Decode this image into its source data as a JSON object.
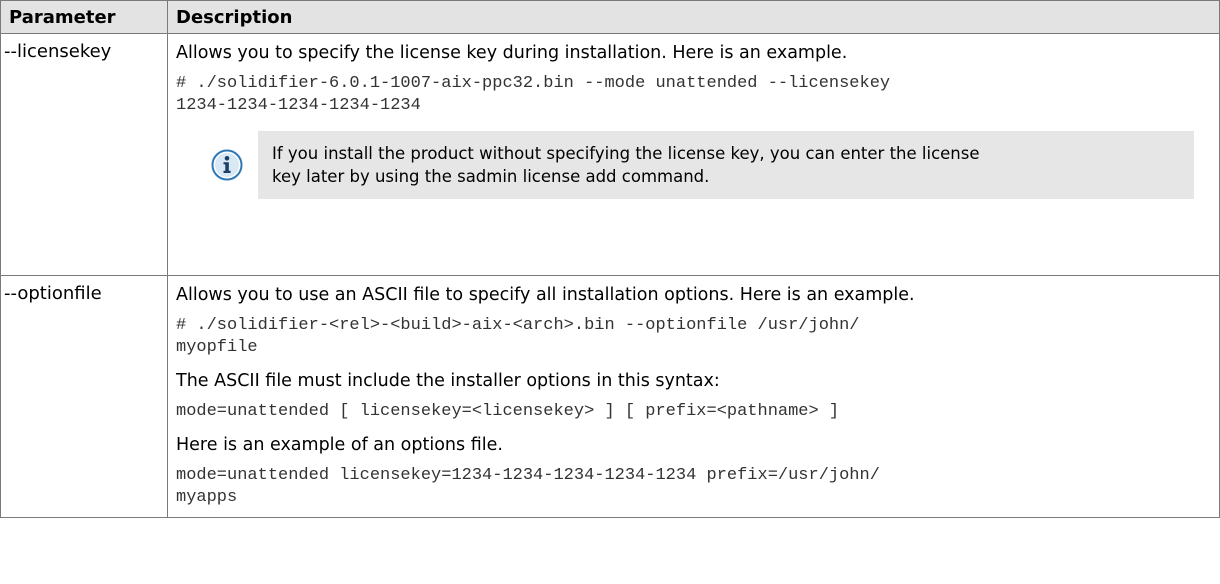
{
  "table": {
    "headers": {
      "parameter": "Parameter",
      "description": "Description"
    },
    "rows": [
      {
        "parameter": "--licensekey",
        "text1": "Allows you to specify the license key during installation. Here is an example.",
        "code1_line1": "# ./solidifier-6.0.1-1007-aix-ppc32.bin --mode unattended --licensekey",
        "code1_line2": "1234-1234-1234-1234-1234",
        "note_line1": "If you install the product without specifying the license key, you can enter the license",
        "note_line2": "key later by using the sadmin license add command.",
        "note_icon": "info-icon"
      },
      {
        "parameter": "--optionfile",
        "text1": "Allows you to use an ASCII file to specify all installation options. Here is an example.",
        "code1_line1": "# ./solidifier-<rel>-<build>-aix-<arch>.bin --optionfile /usr/john/",
        "code1_line2": "myopfile",
        "text2": "The ASCII file must include the installer options in this syntax:",
        "code2": "mode=unattended [ licensekey=<licensekey> ] [ prefix=<pathname> ]",
        "text3": "Here is an example of an options file.",
        "code3_line1": "mode=unattended licensekey=1234-1234-1234-1234-1234 prefix=/usr/john/",
        "code3_line2": "myapps"
      }
    ]
  },
  "colors": {
    "header_bg": "#e3e3e3",
    "note_bg": "#e6e6e6",
    "border": "#7a7a7a",
    "icon_blue": "#2e78b6"
  }
}
